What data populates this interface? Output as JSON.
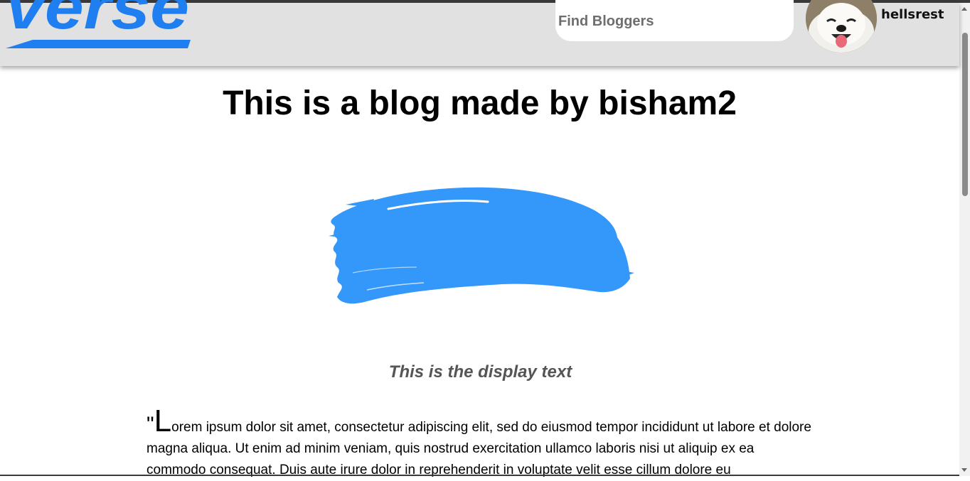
{
  "header": {
    "logo_text": "verse",
    "search": {
      "placeholder": "Find Bloggers",
      "value": ""
    },
    "user": {
      "name": "hellsrest"
    }
  },
  "blog": {
    "title": "This is a blog made by bisham2",
    "display_text": "This is the display text",
    "body": {
      "open_quote": "\"",
      "first_letter": "L",
      "text": "orem ipsum dolor sit amet, consectetur adipiscing elit, sed do eiusmod tempor incididunt ut labore et dolore magna aliqua. Ut enim ad minim veniam, quis nostrud exercitation ullamco laboris nisi ut aliquip ex ea commodo consequat. Duis aute irure dolor in reprehenderit in voluptate velit esse cillum dolore eu"
    }
  },
  "colors": {
    "brand_blue": "#1f7ff0",
    "brush_blue": "#3498fb",
    "header_bg": "#e1e1e1"
  },
  "icons": {
    "avatar": "samoyed-dog-avatar",
    "brush": "blue-paint-brush-stroke"
  }
}
